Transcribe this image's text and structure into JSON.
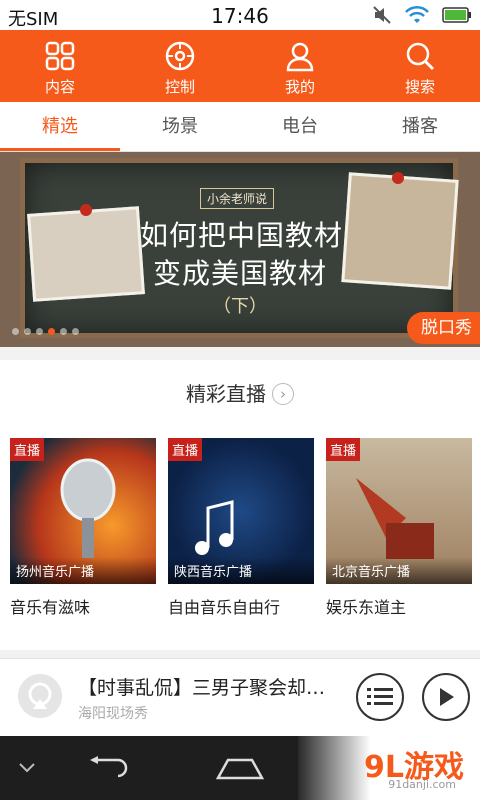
{
  "status": {
    "carrier": "无SIM",
    "time": "17:46"
  },
  "nav": [
    {
      "label": "内容",
      "icon": "grid-icon"
    },
    {
      "label": "控制",
      "icon": "control-icon"
    },
    {
      "label": "我的",
      "icon": "user-icon"
    },
    {
      "label": "搜索",
      "icon": "search-icon"
    }
  ],
  "tabs": [
    {
      "label": "精选",
      "active": true
    },
    {
      "label": "场景",
      "active": false
    },
    {
      "label": "电台",
      "active": false
    },
    {
      "label": "播客",
      "active": false
    }
  ],
  "banner": {
    "tag": "小余老师说",
    "line1": "如何把中国教材",
    "line2": "变成美国教材",
    "line3": "（下）",
    "badge": "脱口秀",
    "page_count": 6,
    "active_page": 4
  },
  "live": {
    "title": "精彩直播",
    "tag": "直播",
    "cards": [
      {
        "station": "扬州音乐广播",
        "name": "音乐有滋味"
      },
      {
        "station": "陕西音乐广播",
        "name": "自由音乐自由行"
      },
      {
        "station": "北京音乐广播",
        "name": "娱乐东道主"
      }
    ]
  },
  "player": {
    "title": "【时事乱侃】三男子聚会却…",
    "subtitle": "海阳现场秀"
  },
  "watermark": {
    "text": "9L游戏",
    "sub": "91danji.com"
  },
  "colors": {
    "accent": "#f65a1a"
  }
}
